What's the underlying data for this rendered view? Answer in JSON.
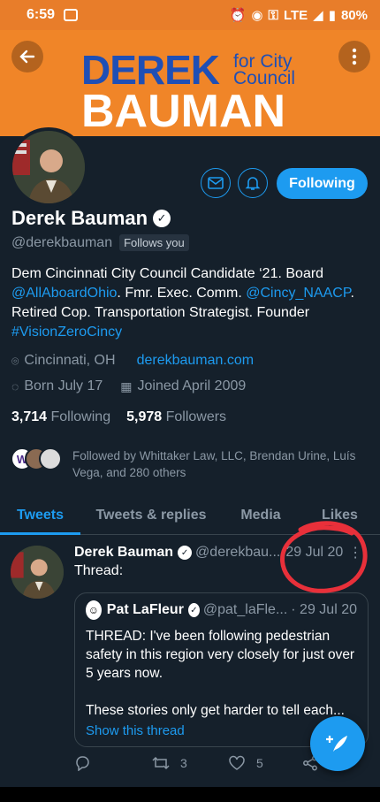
{
  "status_bar": {
    "time": "6:59",
    "network": "LTE",
    "battery": "80%"
  },
  "banner": {
    "line1": "DEREK",
    "for_text": "for City Council",
    "line2": "BAUMAN"
  },
  "profile": {
    "name": "Derek Bauman",
    "handle": "@derekbauman",
    "follows_you": "Follows you",
    "following_button": "Following",
    "bio_text_1": "Dem Cincinnati City Council Candidate ‘21. Board ",
    "bio_link_1": "@AllAboardOhio",
    "bio_text_2": ". Fmr. Exec. Comm. ",
    "bio_link_2": "@Cincy_NAACP",
    "bio_text_3": ". Retired Cop. Transportation Strategist. Founder ",
    "bio_link_3": "#VisionZeroCincy",
    "location": "Cincinnati, OH",
    "website": "derekbauman.com",
    "born": "Born July 17",
    "joined": "Joined April 2009",
    "following_count": "3,714",
    "following_label": "Following",
    "followers_count": "5,978",
    "followers_label": "Followers",
    "followed_by": "Followed by Whittaker Law, LLC, Brendan Urine, Luís Vega, and 280 others"
  },
  "tabs": [
    "Tweets",
    "Tweets & replies",
    "Media",
    "Likes"
  ],
  "tweet": {
    "name": "Derek Bauman",
    "handle": "@derekbau...",
    "date": "29 Jul 20",
    "text": "Thread:",
    "quote": {
      "name": "Pat LaFleur",
      "handle": "@pat_laFle...",
      "date": "· 29 Jul 20",
      "body": "THREAD: I've been following pedestrian safety in this region very closely for just over 5 years now.\n\nThese stories only get harder to tell each...",
      "show_thread": "Show this thread"
    },
    "retweet_count": "3",
    "like_count": "5"
  },
  "colors": {
    "accent": "#1d9bf0",
    "background": "#15202b",
    "banner": "#f08528",
    "annotation": "#e8303a"
  }
}
